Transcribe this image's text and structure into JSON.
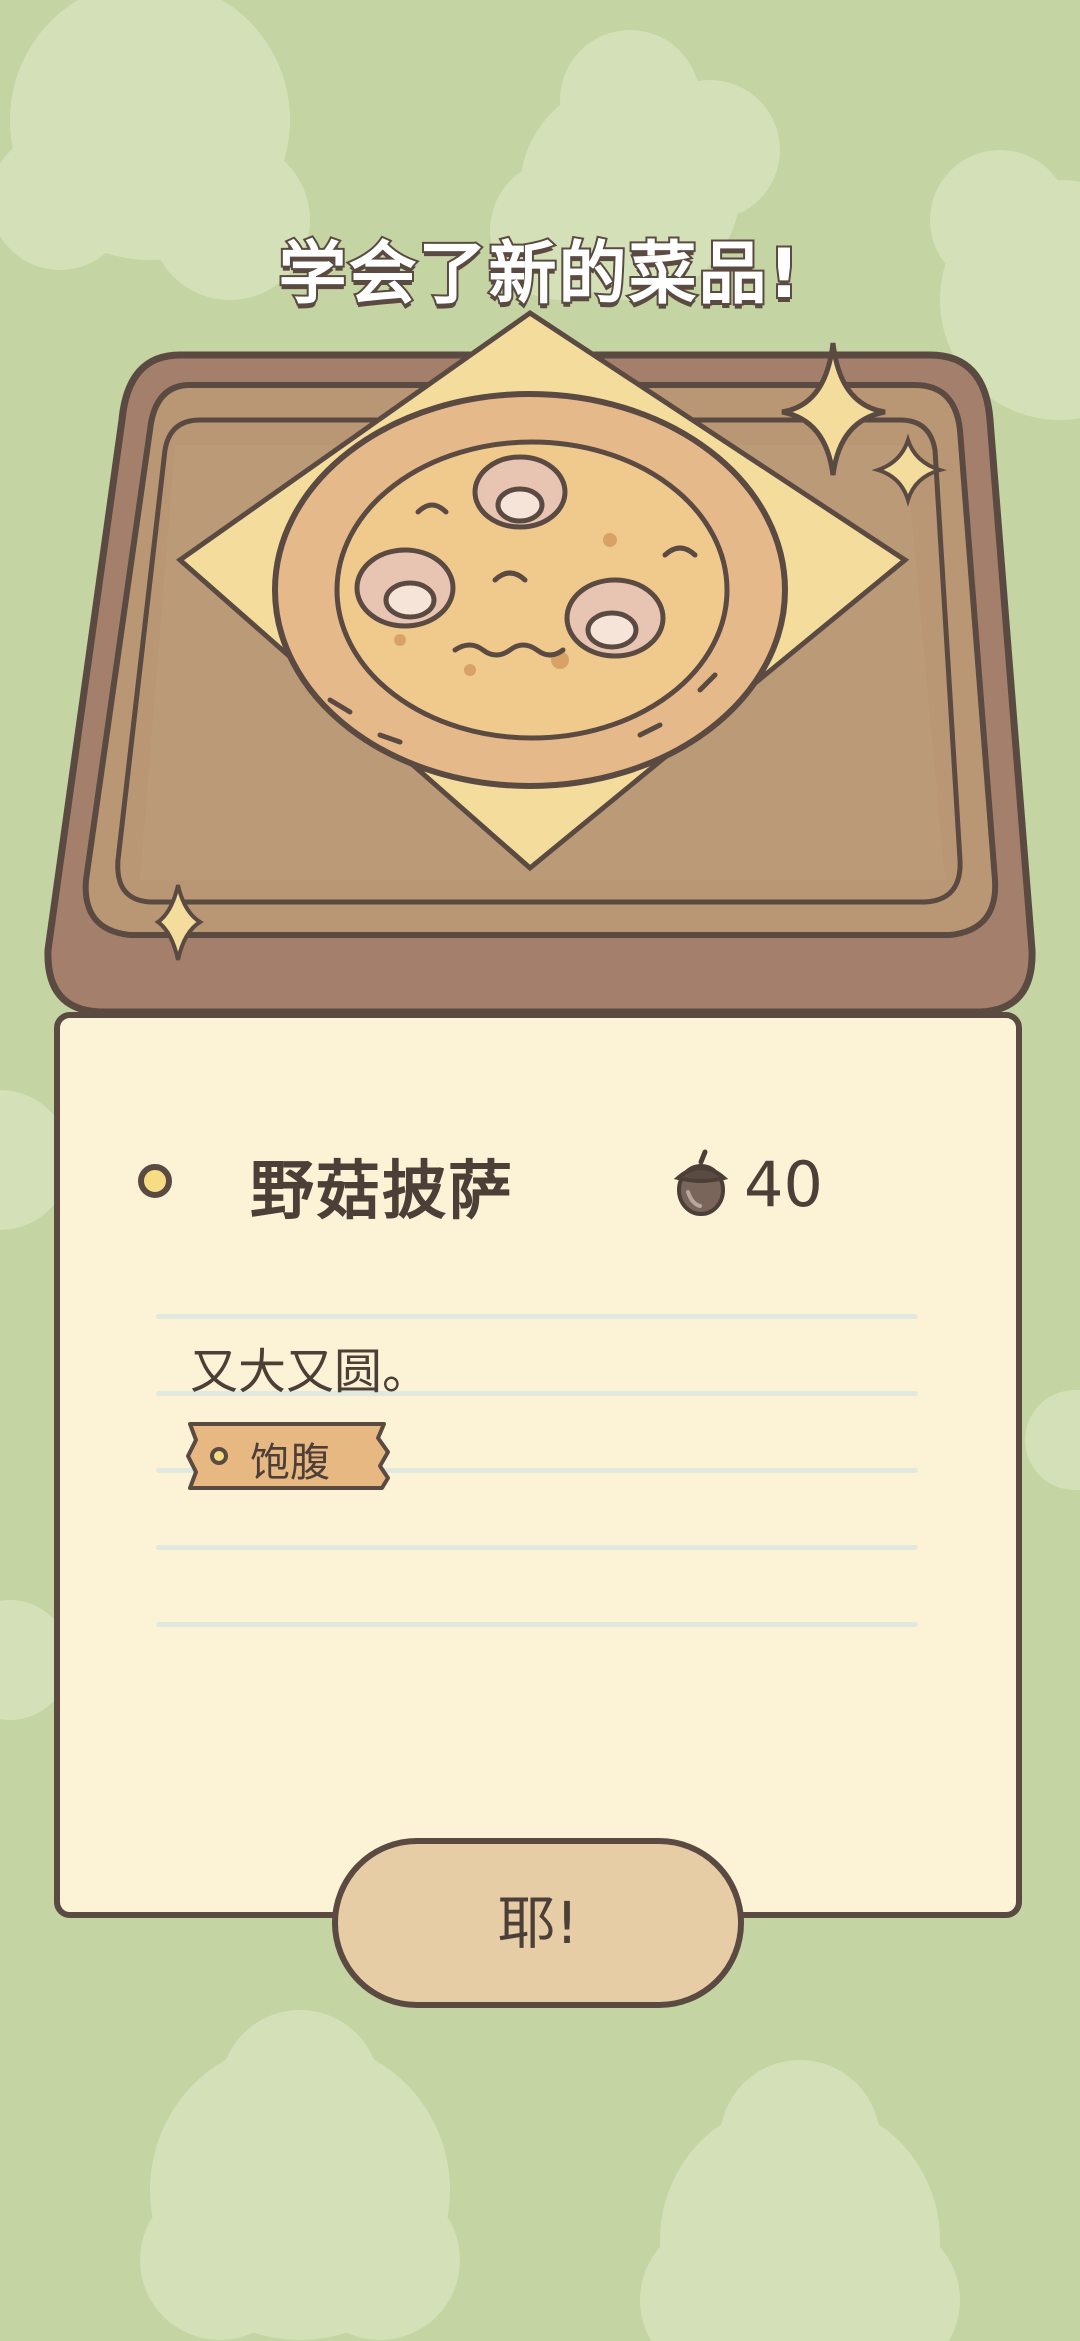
{
  "header": {
    "title": "学会了新的菜品!"
  },
  "dish": {
    "name": "野菇披萨",
    "price": "40",
    "description": "又大又圆。",
    "tag": "饱腹"
  },
  "actions": {
    "confirm_label": "耶!"
  },
  "icons": {
    "currency": "acorn-icon",
    "sparkle": "sparkle-icon",
    "bullet": "dot-icon"
  },
  "colors": {
    "background": "#c4d4a2",
    "card": "#fcf3d7",
    "outline": "#5b4a41",
    "button": "#e6cda6",
    "tag": "#e8b882",
    "tray": "#b99774"
  }
}
